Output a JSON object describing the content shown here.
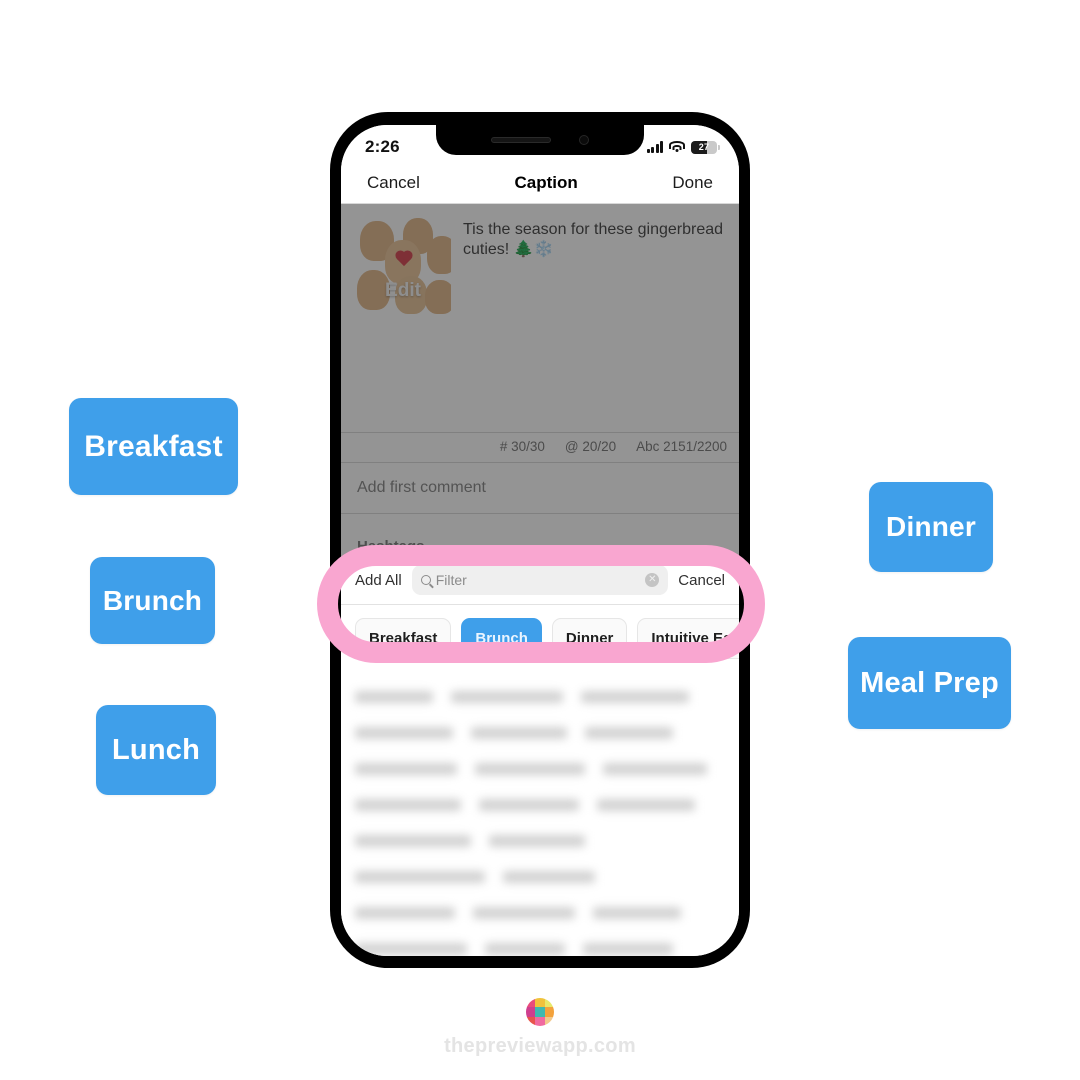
{
  "callouts": {
    "left": [
      {
        "label": "Breakfast"
      },
      {
        "label": "Brunch"
      },
      {
        "label": "Lunch"
      }
    ],
    "right": [
      {
        "label": "Dinner"
      },
      {
        "label": "Meal Prep"
      }
    ],
    "color": "#3f9fea"
  },
  "phone": {
    "status_bar": {
      "time": "2:26",
      "battery_percent": "27"
    },
    "nav_bar": {
      "cancel": "Cancel",
      "title": "Caption",
      "done": "Done"
    },
    "caption_editor": {
      "thumbnail_overlay_label": "Edit",
      "caption_text": "Tis the season for these gingerbread cuties! 🌲❄️",
      "stats": {
        "hashtags": "# 30/30",
        "mentions": "@ 20/20",
        "characters": "Abc 2151/2200"
      },
      "first_comment_placeholder": "Add first comment",
      "section_label": "Hashtags"
    },
    "sheet": {
      "add_all_label": "Add All",
      "search_placeholder": "Filter",
      "cancel_label": "Cancel",
      "chips": [
        {
          "label": "Breakfast",
          "selected": false
        },
        {
          "label": "Brunch",
          "selected": true
        },
        {
          "label": "Dinner",
          "selected": false
        },
        {
          "label": "Intuitive Eating",
          "selected": false
        }
      ]
    }
  },
  "highlight": {
    "color": "#f9a6d0"
  },
  "footer": {
    "site": "thepreviewapp.com",
    "logo_colors": [
      "#e84c7d",
      "#f0c23c",
      "#e8e86a",
      "#cf3f8e",
      "#3fb9b0",
      "#f3a23c",
      "#e8544c",
      "#f06aa0",
      "#f2c98c"
    ]
  }
}
